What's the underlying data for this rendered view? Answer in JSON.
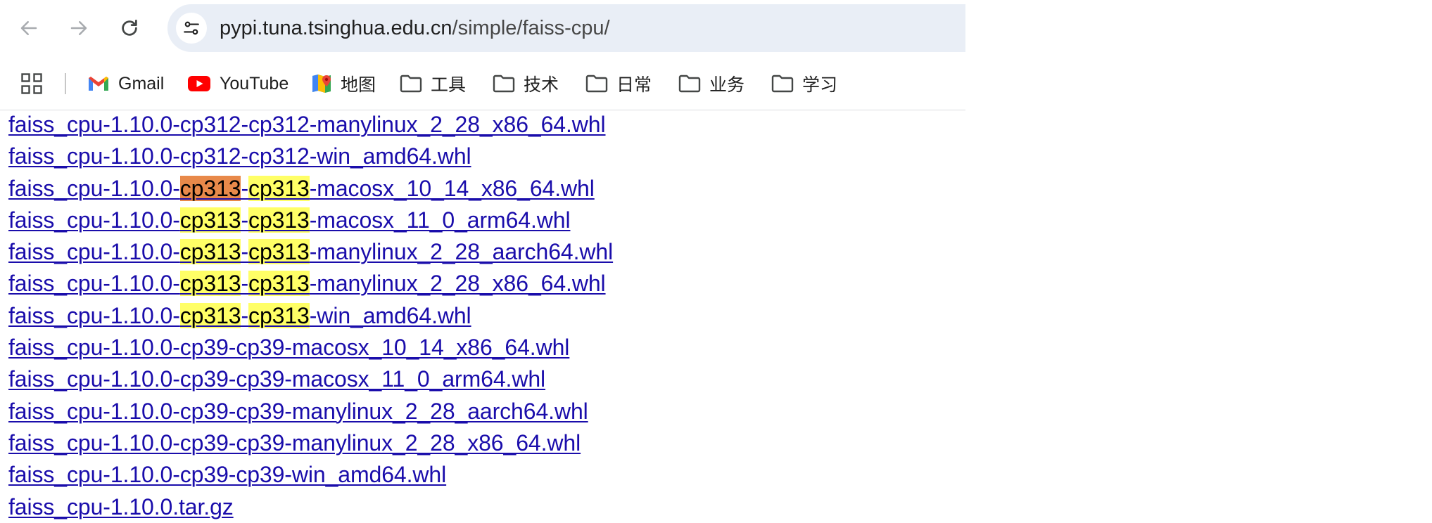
{
  "url": {
    "host": "pypi.tuna.tsinghua.edu.cn",
    "path": "/simple/faiss-cpu/"
  },
  "bookmarks": [
    {
      "label": "Gmail",
      "icon": "gmail-icon"
    },
    {
      "label": "YouTube",
      "icon": "youtube-icon"
    },
    {
      "label": "地图",
      "icon": "maps-icon"
    },
    {
      "label": "工具",
      "icon": "folder-icon"
    },
    {
      "label": "技术",
      "icon": "folder-icon"
    },
    {
      "label": "日常",
      "icon": "folder-icon"
    },
    {
      "label": "业务",
      "icon": "folder-icon"
    },
    {
      "label": "学习",
      "icon": "folder-icon"
    }
  ],
  "search_highlight": "cp313",
  "colors": {
    "link": "#1a0dab",
    "highlight": "#ffff66",
    "active_highlight": "#e8894a"
  },
  "files": [
    {
      "pre": "faiss_cpu-1.10.0-cp312-cp312-manylinux_2_28_x86_64.whl"
    },
    {
      "pre": "faiss_cpu-1.10.0-cp312-cp312-win_amd64.whl"
    },
    {
      "pre": "faiss_cpu-1.10.0-",
      "m1": "cp313",
      "mid": "-",
      "m2": "cp313",
      "post": "-macosx_10_14_x86_64.whl"
    },
    {
      "pre": "faiss_cpu-1.10.0-",
      "m1": "cp313",
      "mid": "-",
      "m2": "cp313",
      "post": "-macosx_11_0_arm64.whl"
    },
    {
      "pre": "faiss_cpu-1.10.0-",
      "m1": "cp313",
      "mid": "-",
      "m2": "cp313",
      "post": "-manylinux_2_28_aarch64.whl"
    },
    {
      "pre": "faiss_cpu-1.10.0-",
      "m1": "cp313",
      "mid": "-",
      "m2": "cp313",
      "post": "-manylinux_2_28_x86_64.whl"
    },
    {
      "pre": "faiss_cpu-1.10.0-",
      "m1": "cp313",
      "mid": "-",
      "m2": "cp313",
      "post": "-win_amd64.whl"
    },
    {
      "pre": "faiss_cpu-1.10.0-cp39-cp39-macosx_10_14_x86_64.whl"
    },
    {
      "pre": "faiss_cpu-1.10.0-cp39-cp39-macosx_11_0_arm64.whl"
    },
    {
      "pre": "faiss_cpu-1.10.0-cp39-cp39-manylinux_2_28_aarch64.whl"
    },
    {
      "pre": "faiss_cpu-1.10.0-cp39-cp39-manylinux_2_28_x86_64.whl"
    },
    {
      "pre": "faiss_cpu-1.10.0-cp39-cp39-win_amd64.whl"
    },
    {
      "pre": "faiss_cpu-1.10.0.tar.gz"
    }
  ]
}
